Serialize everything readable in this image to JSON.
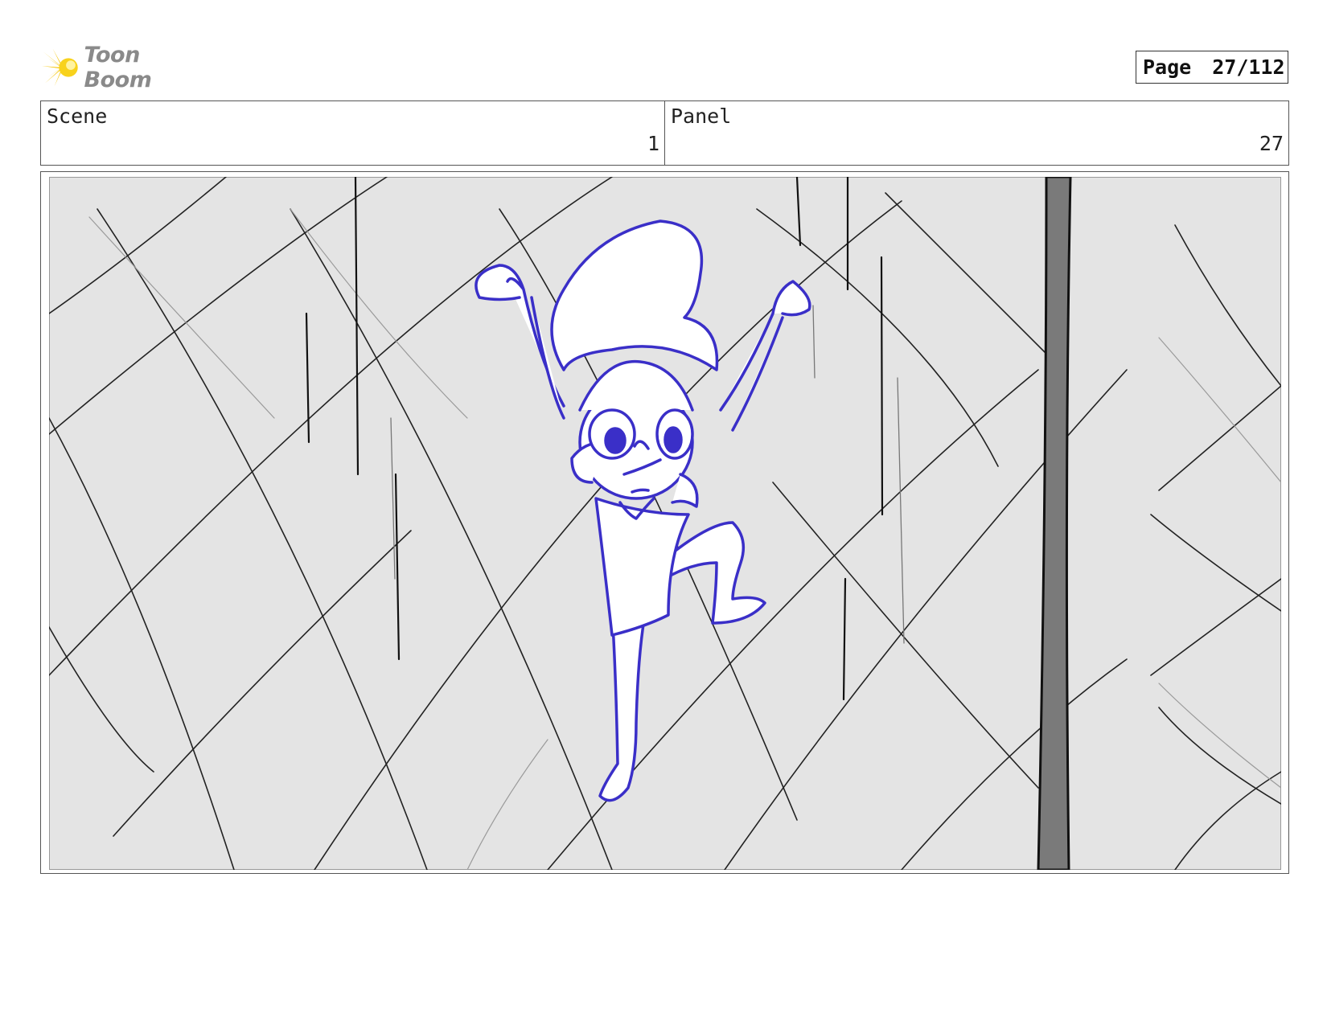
{
  "header": {
    "logo_text": "Toon Boom",
    "page_label": "Page",
    "page_value": "27/112"
  },
  "info": {
    "scene_label": "Scene",
    "scene_value": "1",
    "panel_label": "Panel",
    "panel_value": "27"
  },
  "colors": {
    "sketch_blue": "#3a2fc8",
    "background_gray": "#e4e4e4",
    "logo_yellow": "#f5c400"
  },
  "icons": {
    "logo": "starburst-icon"
  }
}
